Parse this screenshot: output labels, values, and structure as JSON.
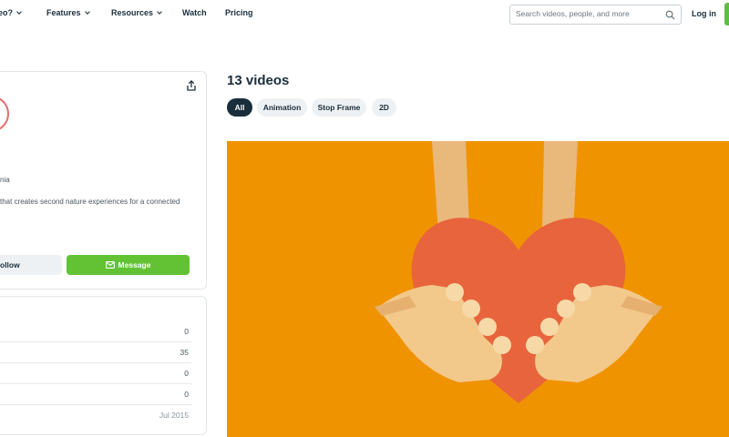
{
  "nav": {
    "items": [
      {
        "label": "eo?",
        "has_chevron": true
      },
      {
        "label": "Features",
        "has_chevron": true
      },
      {
        "label": "Resources",
        "has_chevron": true
      },
      {
        "label": "Watch",
        "has_chevron": false
      },
      {
        "label": "Pricing",
        "has_chevron": false
      }
    ],
    "search_placeholder": "Search videos, people, and more",
    "login_label": "Log in"
  },
  "profile": {
    "location_fragment": "nia",
    "bio_fragment": "that creates second nature experiences for a connected",
    "follow_label": "ollow",
    "message_label": "Message"
  },
  "stats": {
    "values": [
      "0",
      "35",
      "0",
      "0",
      "Jul 2015"
    ]
  },
  "videos": {
    "title": "13 videos",
    "filters": [
      {
        "label": "All",
        "active": true
      },
      {
        "label": "Animation",
        "active": false
      },
      {
        "label": "Stop Frame",
        "active": false
      },
      {
        "label": "2D",
        "active": false
      }
    ]
  },
  "colors": {
    "accent_green": "#62c234",
    "dark_navy": "#1a2e3b",
    "thumb_bg": "#f09300",
    "heart": "#e8643c",
    "skin": "#f2c98a"
  }
}
